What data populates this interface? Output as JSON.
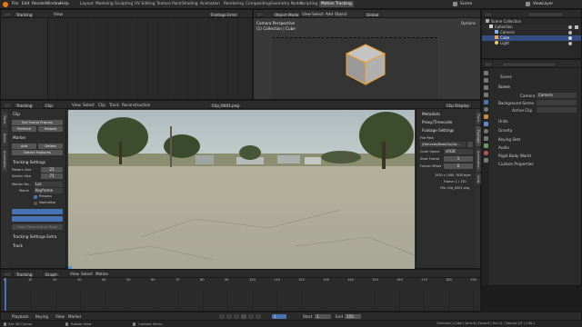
{
  "topbar": {
    "menus": [
      "File",
      "Edit",
      "Render",
      "Window",
      "Help"
    ],
    "workspaces": [
      "Layout",
      "Modeling",
      "Sculpting",
      "UV Editing",
      "Texture Paint",
      "Shading",
      "Animation",
      "Rendering",
      "Compositing",
      "Geometry Nodes",
      "Scripting",
      "Motion Tracking"
    ],
    "active_workspace": "Motion Tracking",
    "scene": "Scene",
    "view_layer": "ViewLayer"
  },
  "dopesheet": {
    "mode": "Tracking",
    "view": "View",
    "display": "Footage Error"
  },
  "viewport3d": {
    "mode": "Object Mode",
    "menus": [
      "View",
      "Select",
      "Add",
      "Object"
    ],
    "transform": "Global",
    "options": "Options",
    "overlay_title": "Camera Perspective",
    "overlay_sub": "(1) Collection | Cube"
  },
  "outliner": {
    "title": "Scene Collection",
    "items": [
      {
        "label": "Collection",
        "color": "#d0d0d0"
      },
      {
        "label": "Camera",
        "color": "#7fb0e6"
      },
      {
        "label": "Cube",
        "color": "#e5a65a",
        "selected": true
      },
      {
        "label": "Light",
        "color": "#e8d26a"
      }
    ]
  },
  "properties": {
    "title": "Scene",
    "section_scene": "Scene",
    "camera_label": "Camera",
    "camera_value": "Camera",
    "background_label": "Background Scene",
    "active_clip_label": "Active Clip",
    "sections": [
      "Units",
      "Gravity",
      "Keying Sets",
      "Audio",
      "Rigid Body World",
      "Custom Properties"
    ]
  },
  "clip_editor": {
    "mode": "Tracking",
    "view_mode": "Clip",
    "menus": [
      "View",
      "Select",
      "Clip",
      "Track",
      "Reconstruction"
    ],
    "clip_name": "Clip_0001.png",
    "display": "Clip Display",
    "toolbar": {
      "clip_header": "Clip",
      "set_scene_frames": "Set Scene Frames",
      "prefetch": "Prefetch",
      "reload": "Reload",
      "marker_header": "Marker",
      "add": "Add",
      "delete": "Delete",
      "detect_features": "Detect Features",
      "tracking_settings": "Tracking Settings",
      "pattern_size_label": "Pattern Size",
      "pattern_size": "21",
      "search_size_label": "Search Size",
      "search_size": "71",
      "motion_model_label": "Motion Mo...",
      "motion_model": "Loc",
      "match_label": "Match",
      "match": "Keyframe",
      "prepass": "Prepass",
      "normalize": "Normalize",
      "copy_from_active": "Copy From Active Track",
      "tracking_settings_extra": "Tracking Settings Extra",
      "track_header": "Track"
    },
    "sidebar": {
      "metadata": "Metadata",
      "proxy": "Proxy/Timecode",
      "footage_settings": "Footage Settings",
      "file_path_label": "File Path",
      "file_path": "//Volumes/Road/Lip/Lip...",
      "color_space_label": "Color Space",
      "color_space": "sRGB",
      "start_frame_label": "Start Frame",
      "start_frame": "1",
      "frame_offset_label": "Frame Offset",
      "frame_offset": "0",
      "info1": "1920 x 1080, RGB byte",
      "info2": "Frame: 1 / 150",
      "info3": "File: Clip_0001.png"
    }
  },
  "graph": {
    "mode": "Tracking",
    "view_mode": "Graph",
    "menus": [
      "View",
      "Select",
      "Motion"
    ],
    "ticks": [
      "0",
      "10",
      "20",
      "30",
      "40",
      "50",
      "60",
      "70",
      "80",
      "90",
      "100",
      "110",
      "120",
      "130",
      "140",
      "150",
      "160",
      "170",
      "180",
      "190"
    ]
  },
  "playbar": {
    "menus": [
      "Playback",
      "Keying",
      "View",
      "Marker"
    ],
    "start_label": "Start",
    "start": "1",
    "end_label": "End",
    "end": "150",
    "current": "1"
  },
  "statusbar": {
    "items": [
      "Set 3D Cursor",
      "Rotate View",
      "Context Menu"
    ],
    "stats": "Collection | Cube | Verts:8 | Faces:6 | Tris:12 | Objects:1/3 | 2.90.1"
  },
  "colors": {
    "accent": "#4772b3",
    "header": "#2b2b2b",
    "panel": "#303030",
    "cube_outline": "#f0a030"
  }
}
